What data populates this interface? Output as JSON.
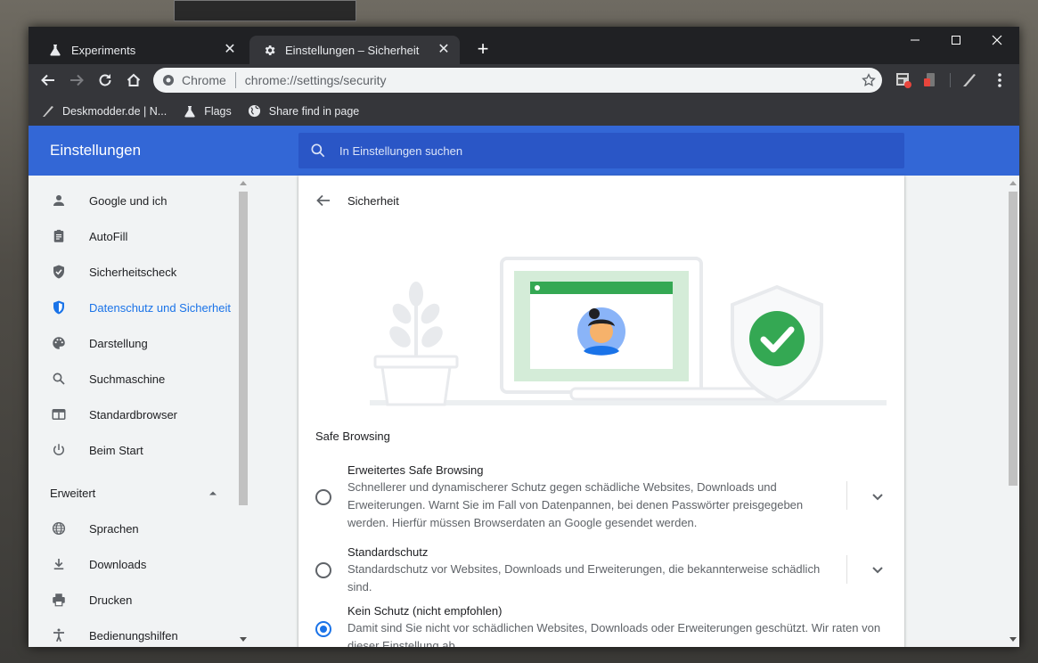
{
  "tabs": [
    {
      "label": "Experiments",
      "icon": "flask-icon"
    },
    {
      "label": "Einstellungen – Sicherheit",
      "icon": "gear-icon"
    }
  ],
  "toolbar": {
    "omnibox_chip": "Chrome",
    "url": "chrome://settings/security"
  },
  "bookmarks": [
    {
      "label": "Deskmodder.de | N...",
      "icon": "quill-icon"
    },
    {
      "label": "Flags",
      "icon": "flask-icon"
    },
    {
      "label": "Share find in page",
      "icon": "globe-icon"
    }
  ],
  "settings": {
    "title": "Einstellungen",
    "search_placeholder": "In Einstellungen suchen"
  },
  "sidebar": {
    "items": [
      {
        "label": "Google und ich",
        "icon": "person-icon"
      },
      {
        "label": "AutoFill",
        "icon": "clipboard-icon"
      },
      {
        "label": "Sicherheitscheck",
        "icon": "shield-check-icon"
      },
      {
        "label": "Datenschutz und Sicherheit",
        "icon": "shield-half-icon"
      },
      {
        "label": "Darstellung",
        "icon": "palette-icon"
      },
      {
        "label": "Suchmaschine",
        "icon": "search-icon"
      },
      {
        "label": "Standardbrowser",
        "icon": "browser-icon"
      },
      {
        "label": "Beim Start",
        "icon": "power-icon"
      }
    ],
    "advanced_label": "Erweitert",
    "advanced_items": [
      {
        "label": "Sprachen",
        "icon": "globe-icon"
      },
      {
        "label": "Downloads",
        "icon": "download-icon"
      },
      {
        "label": "Drucken",
        "icon": "printer-icon"
      },
      {
        "label": "Bedienungshilfen",
        "icon": "accessibility-icon"
      }
    ],
    "selected_index": 3
  },
  "main": {
    "title": "Sicherheit",
    "section_title": "Safe Browsing",
    "options": [
      {
        "title": "Erweitertes Safe Browsing",
        "desc_lines": [
          "Schnellerer und dynamischerer Schutz gegen schädliche Websites, Downloads und",
          "Erweiterungen. Warnt Sie im Fall von Datenpannen, bei denen Passwörter preisgegeben",
          "werden. Hierfür müssen Browserdaten an Google gesendet werden."
        ],
        "selected": false
      },
      {
        "title": "Standardschutz",
        "desc_lines": [
          "Standardschutz vor Websites, Downloads und Erweiterungen, die bekannterweise schädlich",
          "sind."
        ],
        "selected": false
      },
      {
        "title": "Kein Schutz (nicht empfohlen)",
        "desc_lines": [
          "Damit sind Sie nicht vor schädlichen Websites, Downloads oder Erweiterungen geschützt. Wir raten von",
          "dieser Einstellung ab."
        ],
        "selected": true
      }
    ]
  },
  "colors": {
    "header_blue": "#3367d6",
    "accent": "#1a73e8",
    "shield_green": "#34a853",
    "laptop_green": "#d4ecd8"
  }
}
